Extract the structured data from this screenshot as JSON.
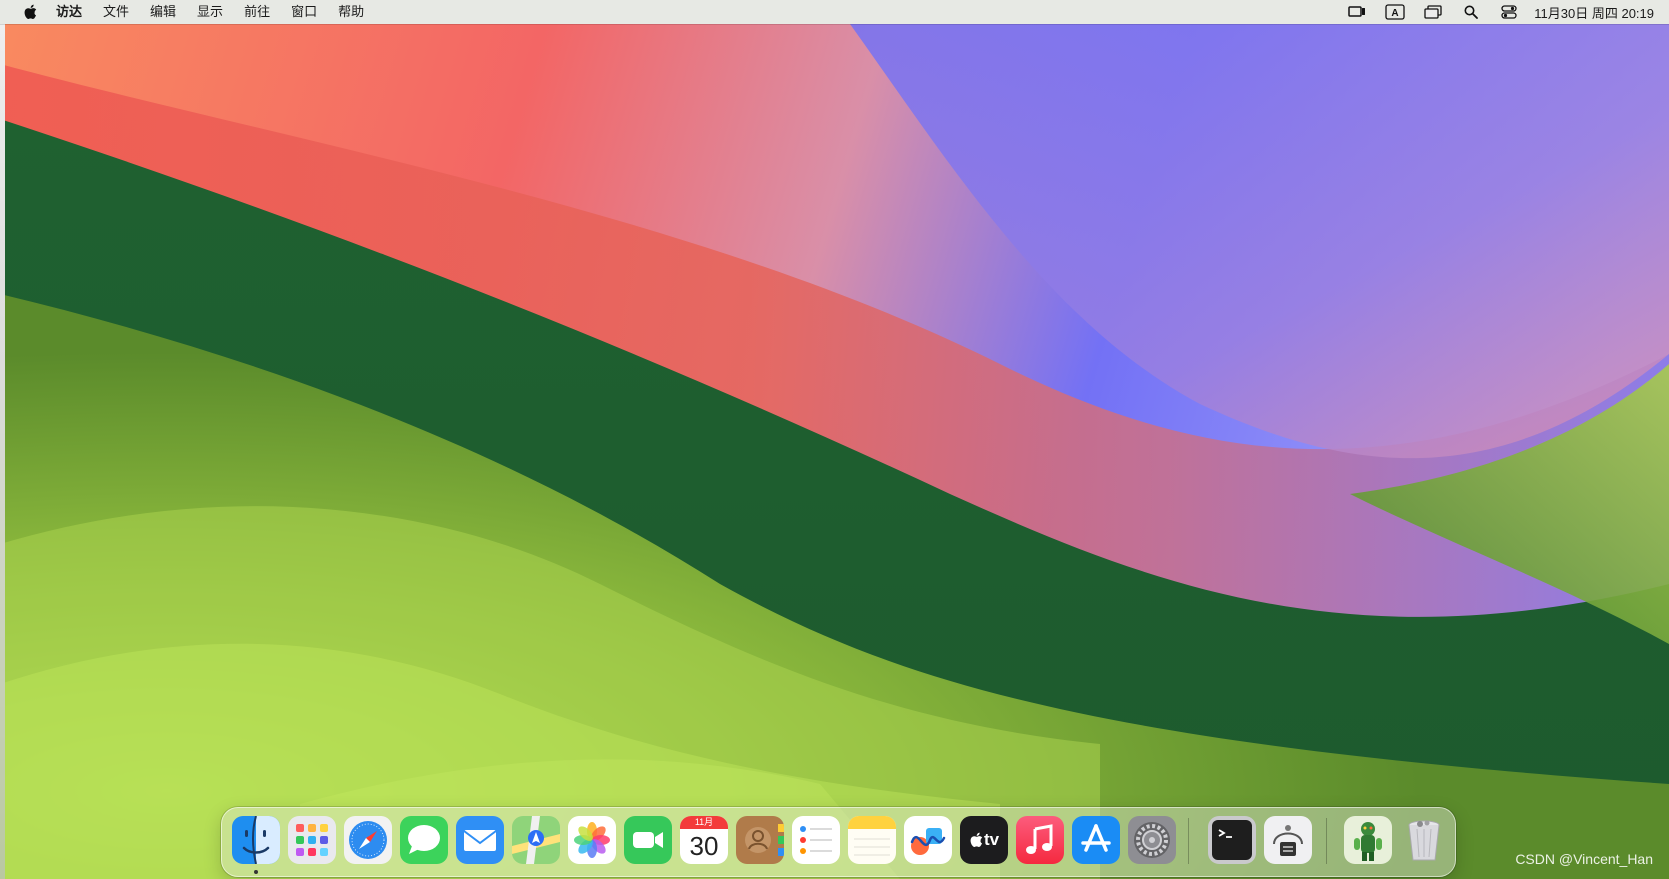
{
  "menubar": {
    "app_name": "访达",
    "items": [
      "文件",
      "编辑",
      "显示",
      "前往",
      "窗口",
      "帮助"
    ],
    "status_icons": [
      "screen-mirroring-icon",
      "input-source-icon",
      "window-overview-icon",
      "spotlight-search-icon",
      "control-center-icon"
    ],
    "input_source_label": "A",
    "clock": "11月30日 周四  20:19"
  },
  "dock": {
    "apps": [
      "finder",
      "launchpad",
      "safari",
      "messages",
      "mail",
      "maps",
      "photos",
      "facetime",
      "calendar",
      "contacts",
      "reminders",
      "notes",
      "freeform",
      "tv",
      "music",
      "app-store",
      "system-settings",
      "terminal",
      "utility",
      "figure-app",
      "trash"
    ],
    "calendar_month": "11月",
    "calendar_day": "30",
    "tv_label": "tv"
  },
  "watermark": "CSDN @Vincent_Han",
  "colors": {
    "menubar_bg": "#ececec",
    "wall_orange": "#f98a60",
    "wall_red": "#f36665",
    "wall_pink": "#d98fa8",
    "wall_blue": "#7371f5",
    "wall_green_dark": "#1d5a2e",
    "wall_green_light": "#bde858"
  }
}
